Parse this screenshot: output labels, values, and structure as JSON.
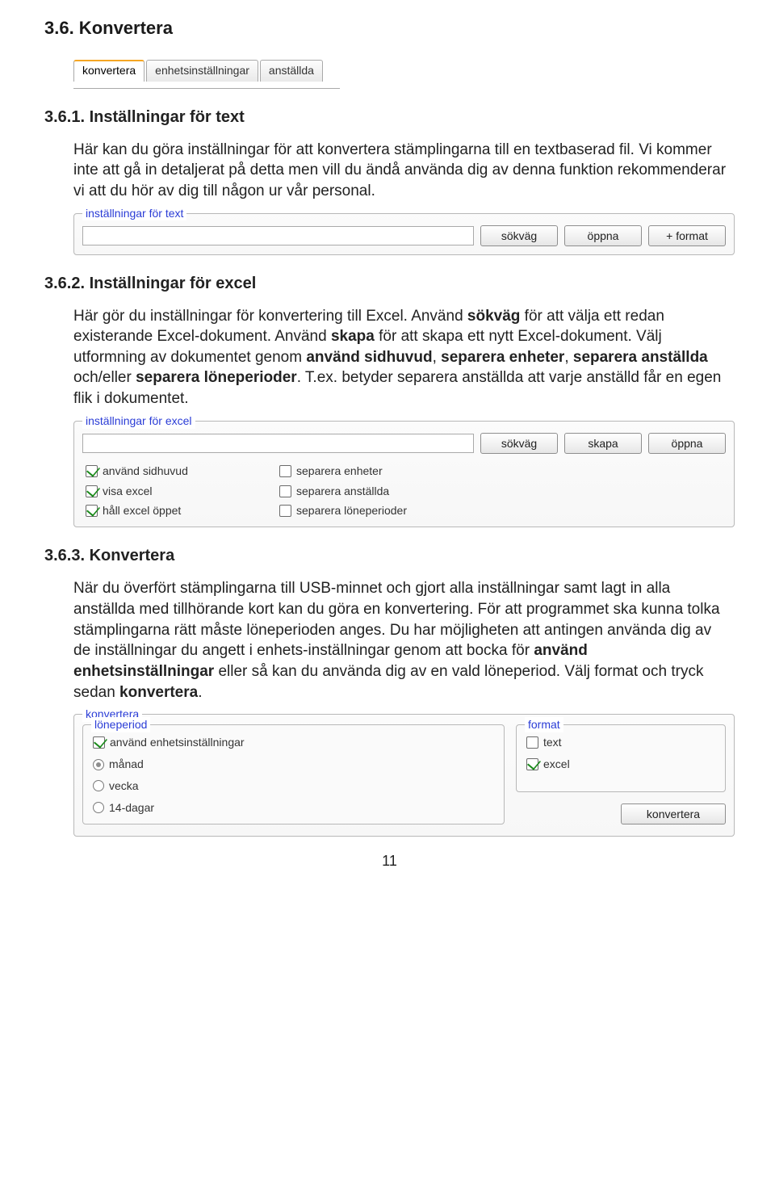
{
  "section36": {
    "title": "3.6. Konvertera",
    "tabs": [
      "konvertera",
      "enhetsinställningar",
      "anställda"
    ]
  },
  "s361": {
    "title": "3.6.1. Inställningar för text",
    "p1": "Här kan du göra inställningar för att konvertera stämplingarna till en textbaserad fil. Vi kommer inte att gå in detaljerat på detta men vill du ändå använda dig av denna funktion rekommenderar vi att du hör av dig till någon ur vår personal.",
    "legend": "inställningar för text",
    "buttons": {
      "path": "sökväg",
      "open": "öppna",
      "addformat": "+ format"
    }
  },
  "s362": {
    "title": "3.6.2. Inställningar för excel",
    "p1a": "Här gör du inställningar för konvertering till Excel. Använd ",
    "p1b_bold": "sökväg",
    "p1c": " för att välja ett redan existerande Excel-dokument. Använd ",
    "p1d_bold": "skapa",
    "p1e": " för att skapa ett nytt Excel-dokument. Välj utformning av dokumentet genom  ",
    "p1f_bold": "använd sidhuvud",
    "p1g": ", ",
    "p1h_bold": "separera enheter",
    "p1i": ", ",
    "p1j_bold": "separera anställda",
    "p1k": " och/eller ",
    "p1l_bold": "separera löneperioder",
    "p1m": ". T.ex. betyder separera anställda att varje anställd får en egen flik i dokumentet.",
    "legend": "inställningar för excel",
    "buttons": {
      "path": "sökväg",
      "create": "skapa",
      "open": "öppna"
    },
    "checks": {
      "use_header": "använd sidhuvud",
      "show_excel": "visa excel",
      "keep_open": "håll excel öppet",
      "sep_units": "separera enheter",
      "sep_emp": "separera anställda",
      "sep_pay": "separera löneperioder"
    }
  },
  "s363": {
    "title": "3.6.3. Konvertera",
    "p1a": "När du överfört stämplingarna till USB-minnet och gjort alla inställningar samt lagt in alla anställda med tillhörande kort kan du göra en konvertering. För att programmet ska kunna tolka stämplingarna rätt måste löneperioden anges. Du har möjligheten att antingen använda dig av de inställningar du angett i enhets-inställningar genom att bocka för ",
    "p1b_bold": "använd enhetsinställningar",
    "p1c": " eller så kan du använda dig av en vald löneperiod. Välj format och tryck sedan ",
    "p1d_bold": "konvertera",
    "p1e": ".",
    "legend": "konvertera",
    "panel": {
      "period_legend": "löneperiod",
      "use_unit": "använd enhetsinställningar",
      "radios": {
        "month": "månad",
        "week": "vecka",
        "days14": "14-dagar"
      },
      "format_legend": "format",
      "format_text": "text",
      "format_excel": "excel",
      "btn": "konvertera"
    }
  },
  "page_number": "11"
}
